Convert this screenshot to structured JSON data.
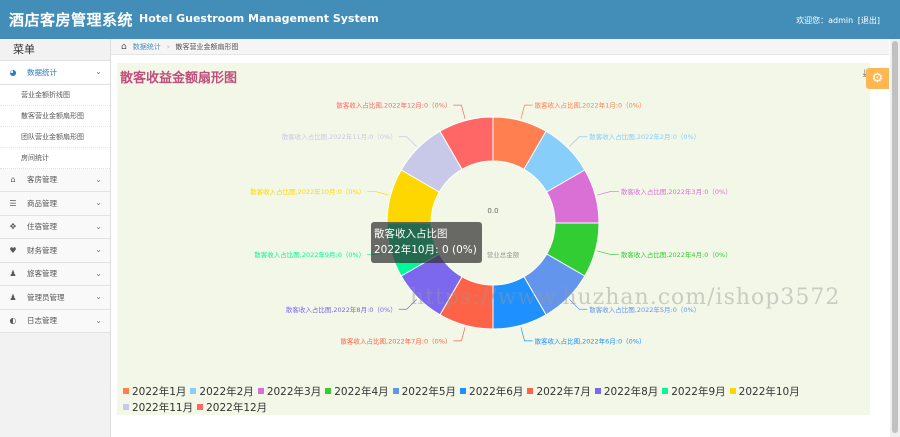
{
  "header": {
    "title_cn": "酒店客房管理系统",
    "title_en": "Hotel Guestroom Management System",
    "welcome": "欢迎您：admin",
    "logout": "[退出]"
  },
  "sidebar": {
    "menu_title": "菜单",
    "items": [
      {
        "label": "数据统计",
        "icon": "dashboard-icon",
        "glyph": "◕",
        "open": true,
        "children": [
          "营业金额折线图",
          "散客营业金额扇形图",
          "团队营业金额扇形图",
          "房间统计"
        ]
      },
      {
        "label": "客房管理",
        "icon": "home-icon",
        "glyph": "⌂"
      },
      {
        "label": "商品管理",
        "icon": "database-icon",
        "glyph": "☰"
      },
      {
        "label": "住宿管理",
        "icon": "arrows-icon",
        "glyph": "✥"
      },
      {
        "label": "财务管理",
        "icon": "heart-icon",
        "glyph": "♥"
      },
      {
        "label": "旅客管理",
        "icon": "user-icon",
        "glyph": "♟"
      },
      {
        "label": "管理员管理",
        "icon": "admin-icon",
        "glyph": "♟"
      },
      {
        "label": "日志管理",
        "icon": "adjust-icon",
        "glyph": "◐"
      }
    ]
  },
  "breadcrumb": {
    "home_icon": "home-icon",
    "parent": "数据统计",
    "current": "散客营业金额扇形图"
  },
  "panel": {
    "title": "散客收益金额扇形图",
    "download_icon": "download-icon"
  },
  "settings_icon": "gear-icon",
  "tooltip": {
    "title": "散客收入占比图",
    "value": "2022年10月: 0 (0%)"
  },
  "watermark": "https://www.huzhan.com/ishop3572",
  "chart_data": {
    "type": "pie",
    "variant": "donut",
    "series_name": "散客收入占比图",
    "center_value": "0.0",
    "center_label": "营业总金额",
    "categories": [
      "2022年1月",
      "2022年2月",
      "2022年3月",
      "2022年4月",
      "2022年5月",
      "2022年6月",
      "2022年7月",
      "2022年8月",
      "2022年9月",
      "2022年10月",
      "2022年11月",
      "2022年12月"
    ],
    "values": [
      0,
      0,
      0,
      0,
      0,
      0,
      0,
      0,
      0,
      0,
      0,
      0
    ],
    "percents": [
      "0%",
      "0%",
      "0%",
      "0%",
      "0%",
      "0%",
      "0%",
      "0%",
      "0%",
      "0%",
      "0%",
      "0%"
    ],
    "labels": [
      "散客收入占比图,2022年1月:0（0%）",
      "散客收入占比图,2022年2月:0（0%）",
      "散客收入占比图,2022年3月:0（0%）",
      "散客收入占比图,2022年4月:0（0%）",
      "散客收入占比图,2022年5月:0（0%）",
      "散客收入占比图,2022年6月:0（0%）",
      "散客收入占比图,2022年7月:0（0%）",
      "散客收入占比图,2022年8月:0（0%）",
      "散客收入占比图,2022年9月:0（0%）",
      "散客收入占比图,2022年10月:0（0%）",
      "散客收入占比图,2022年11月:0（0%）",
      "散客收入占比图,2022年12月:0（0%）"
    ],
    "colors": [
      "#ff7f50",
      "#87cefa",
      "#da70d6",
      "#32cd32",
      "#6495ed",
      "#1e90ff",
      "#ff6347",
      "#7b68ee",
      "#00fa9a",
      "#ffd700",
      "#c8c8e8",
      "#ff6666"
    ],
    "legend_position": "bottom"
  }
}
